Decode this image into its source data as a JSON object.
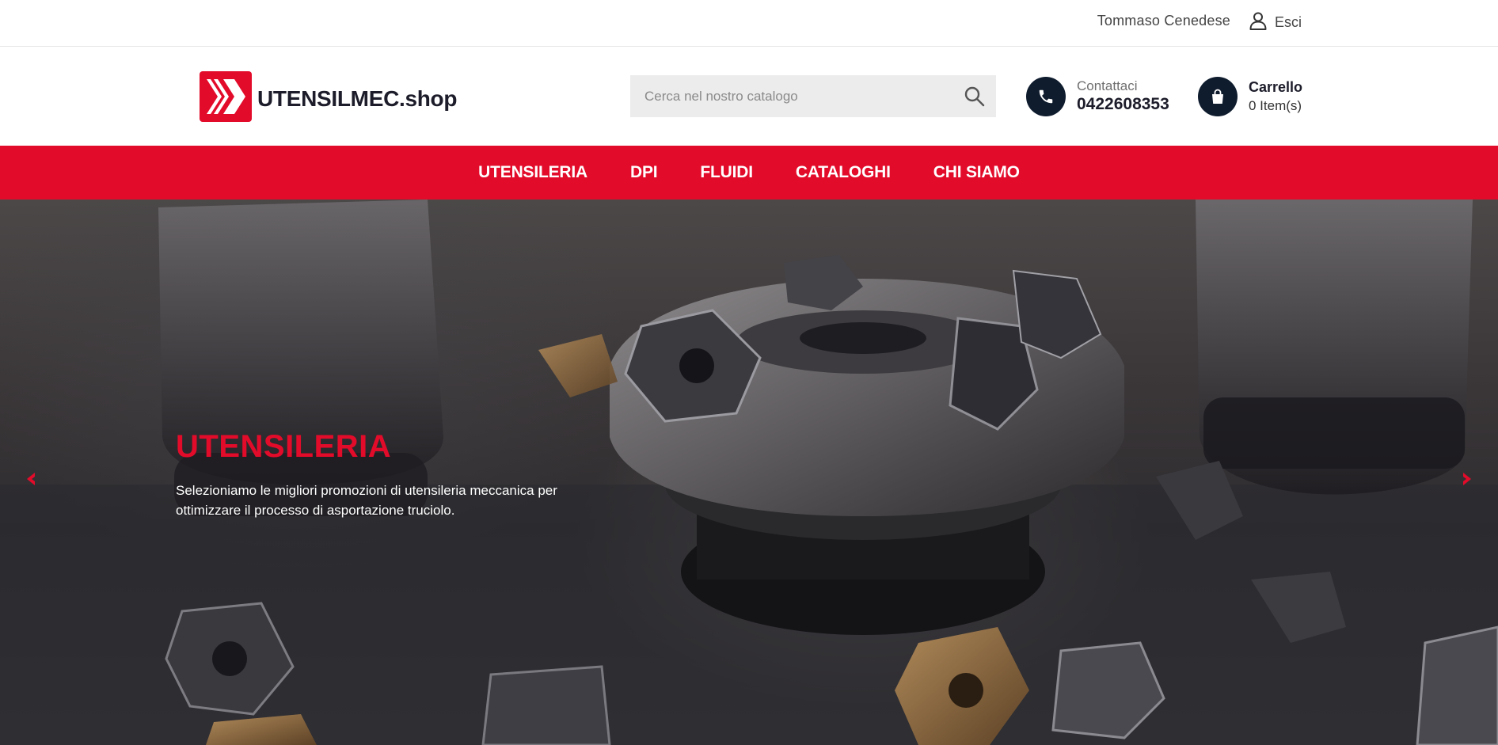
{
  "topbar": {
    "user_name": "Tommaso Cenedese",
    "logout_label": "Esci"
  },
  "header": {
    "logo_text": "UTENSILMEC.shop",
    "search_placeholder": "Cerca nel nostro catalogo",
    "contact_label": "Contattaci",
    "contact_phone": "0422608353",
    "cart_label": "Carrello",
    "cart_count": "0 Item(s)"
  },
  "nav": {
    "items": [
      "UTENSILERIA",
      "DPI",
      "FLUIDI",
      "CATALOGHI",
      "CHI SIAMO"
    ]
  },
  "hero": {
    "title": "UTENSILERIA",
    "description": "Selezioniamo le migliori promozioni di utensileria meccanica per ottimizzare il processo di asportazione truciolo."
  },
  "colors": {
    "brand_red": "#e30b2a",
    "dark_navy": "#0f1c2e"
  }
}
